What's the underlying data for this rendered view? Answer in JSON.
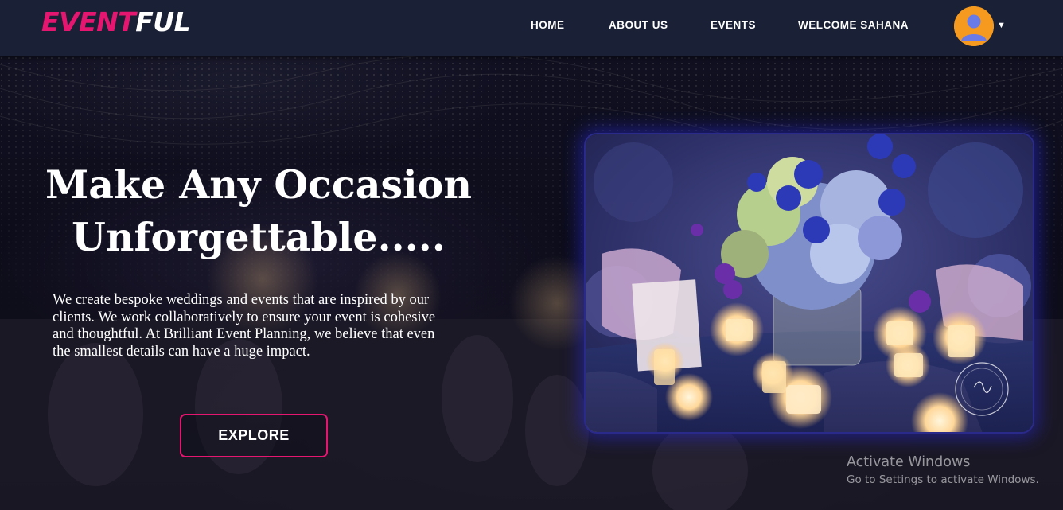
{
  "brand": {
    "part1": "EVENT",
    "part2": "FUL",
    "accent": "#e5166f"
  },
  "nav": {
    "home": "HOME",
    "about": "ABOUT US",
    "events": "EVENTS",
    "welcome": "WELCOME SAHANA",
    "avatar_icon": "user-avatar-icon",
    "caret_icon": "chevron-down-icon"
  },
  "hero": {
    "headline_line1": "Make Any Occasion",
    "headline_line2": "Unforgettable.....",
    "description": "We create bespoke weddings and events that are inspired by our clients. We work collaboratively to ensure your event is cohesive and thoughtful. At Brilliant Event Planning, we believe that even the smallest details can have a huge impact.",
    "explore_label": "EXPLORE"
  },
  "photo": {
    "subject": "table-centerpiece-image",
    "watermark_icon": "studio-watermark-icon"
  },
  "windows_watermark": {
    "title": "Activate Windows",
    "subtitle": "Go to Settings to activate Windows."
  },
  "colors": {
    "navbar": "#1a2035",
    "accent": "#e5166f",
    "avatar": "#f59a1f",
    "card_glow": "#2a2a8a"
  }
}
